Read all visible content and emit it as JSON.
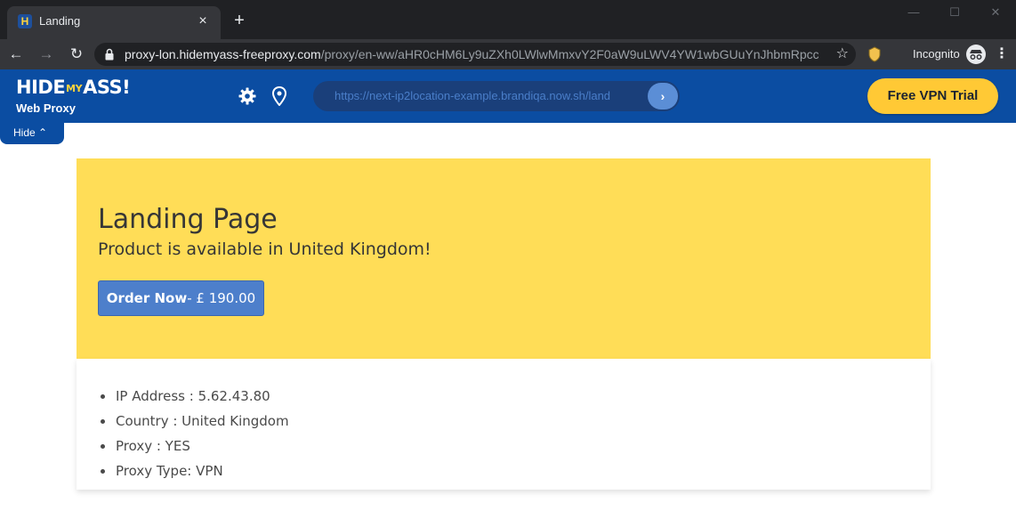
{
  "browser": {
    "tab": {
      "title": "Landing",
      "favicon": "H",
      "close_icon": "×"
    },
    "new_tab_icon": "+",
    "address": {
      "host": "proxy-lon.hidemyass-freeproxy.com",
      "path": "/proxy/en-ww/aHR0cHM6Ly9uZXh0LWlwMmxvY2F0aW9uLWV4YW1wbGUuYnJhbmRpcc..."
    },
    "incognito_label": "Incognito",
    "icons": [
      "back-icon",
      "forward-icon",
      "reload-icon",
      "lock-icon",
      "star-icon",
      "extension-icon",
      "incognito-icon",
      "menu-icon",
      "minimize-icon",
      "maximize-icon"
    ]
  },
  "hma": {
    "logo_hide": "HIDE",
    "logo_my": "MY",
    "logo_ass": "ASS!",
    "logo_sub": "Web Proxy",
    "url_value": "https://next-ip2location-example.brandiqa.now.sh/land",
    "go_label": "›",
    "trial_label": "Free VPN Trial",
    "hide_label": "Hide ⌃",
    "colors": {
      "bar": "#0b4da2",
      "trial": "#ffc935"
    }
  },
  "page": {
    "title": "Landing Page",
    "subtitle": "Product is available in United Kingdom!",
    "order_label": "Order Now",
    "order_price": "- £ 190.00",
    "info": [
      "IP Address : 5.62.43.80",
      "Country : United Kingdom",
      "Proxy : YES",
      "Proxy Type: VPN"
    ],
    "colors": {
      "hero": "#ffdd57",
      "button": "#4d7fcb"
    }
  }
}
